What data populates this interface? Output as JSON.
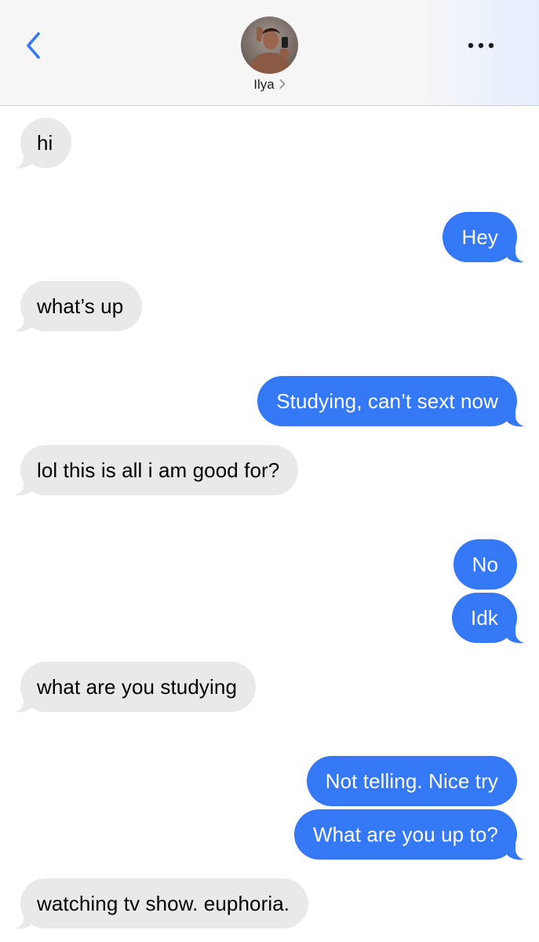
{
  "header": {
    "contact_name": "Ilya",
    "icons": {
      "back": "chevron-left-icon",
      "name_chevron": "chevron-right-icon",
      "more": "more-dots-icon"
    },
    "accent_color": "#3478f6"
  },
  "messages": [
    {
      "direction": "incoming",
      "text": "hi"
    },
    {
      "direction": "outgoing",
      "text": "Hey"
    },
    {
      "direction": "incoming",
      "text": "what’s up"
    },
    {
      "direction": "outgoing",
      "text": "Studying, can’t sext now"
    },
    {
      "direction": "incoming",
      "text": "lol this is all i am good for?"
    },
    {
      "direction": "outgoing",
      "text": "No"
    },
    {
      "direction": "outgoing",
      "text": "Idk"
    },
    {
      "direction": "incoming",
      "text": "what are you studying"
    },
    {
      "direction": "outgoing",
      "text": "Not telling. Nice try"
    },
    {
      "direction": "outgoing",
      "text": "What are you up to?"
    },
    {
      "direction": "incoming",
      "text": "watching tv show. euphoria."
    }
  ],
  "colors": {
    "incoming_bubble": "#e9e9eb",
    "outgoing_bubble": "#3478f6",
    "header_bg": "#f6f6f7"
  }
}
